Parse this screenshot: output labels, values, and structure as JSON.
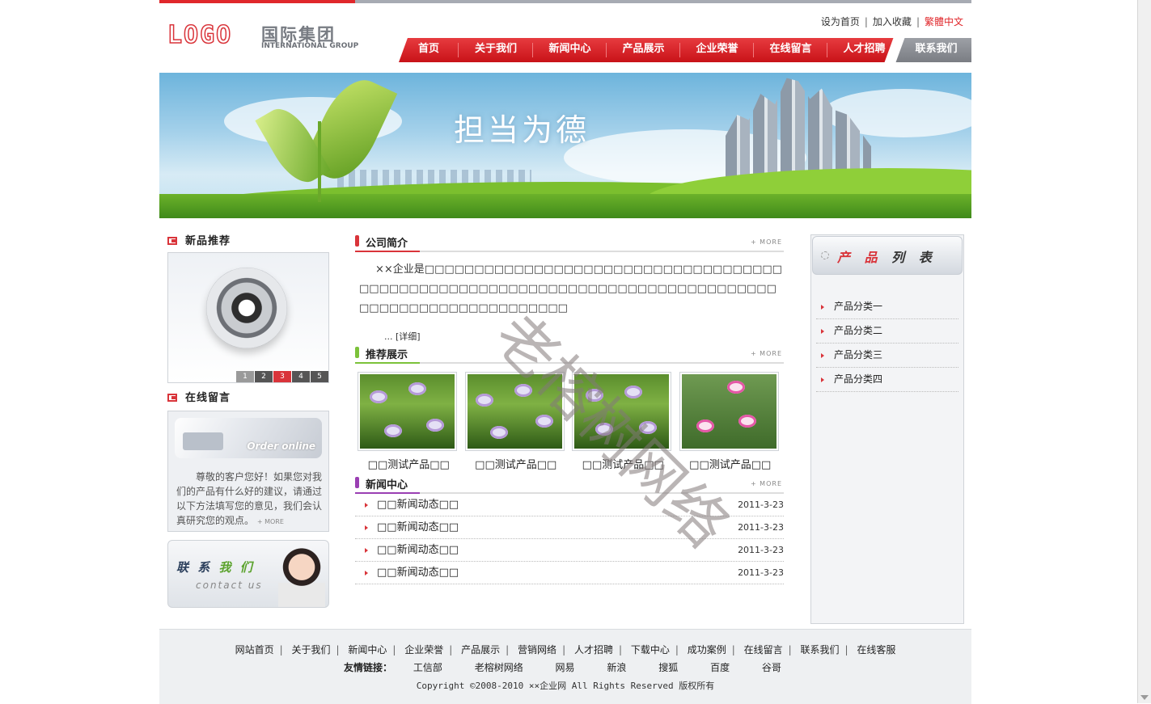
{
  "header": {
    "logo_mark": "LOGO",
    "logo_cn": "国际集团",
    "logo_en": "INTERNATIONAL GROUP",
    "top_links": [
      "设为首页",
      "加入收藏",
      "繁體中文"
    ],
    "nav": [
      "首页",
      "关于我们",
      "新闻中心",
      "产品展示",
      "企业荣誉",
      "在线留言",
      "人才招聘"
    ],
    "nav_contact": "联系我们"
  },
  "banner": {
    "slogan": "担当为德"
  },
  "left": {
    "new_products_title": "新品推荐",
    "pager": [
      "1",
      "2",
      "3",
      "4",
      "5"
    ],
    "message_title": "在线留言",
    "order_online": "Order online",
    "message_text": "尊敬的客户您好！如果您对我们的产品有什么好的建议，请通过以下方法填写您的意见，我们会认真研究您的观点。",
    "message_more": "+ MORE",
    "contact_cn_1": "联 系",
    "contact_cn_2": "我 们",
    "contact_en": "contact us"
  },
  "intro": {
    "title": "公司简介",
    "more": "+ MORE",
    "text": "××企业是□□□□□□□□□□□□□□□□□□□□□□□□□□□□□□□□□□□□□□□□□□□□□□□□□□□□□□□□□□□□□□□□□□□□□□□□□□□□□□□□□□□□□□□□□□□□□□□□□□□",
    "detail": "... [详细]"
  },
  "featured": {
    "title": "推荐展示",
    "more": "+ MORE",
    "items": [
      "□□测试产品□□",
      "□□测试产品□□",
      "□□测试产品□□",
      "□□测试产品□□"
    ]
  },
  "news": {
    "title": "新闻中心",
    "more": "+ MORE",
    "items": [
      {
        "title": "□□新闻动态□□",
        "date": "2011-3-23"
      },
      {
        "title": "□□新闻动态□□",
        "date": "2011-3-23"
      },
      {
        "title": "□□新闻动态□□",
        "date": "2011-3-23"
      },
      {
        "title": "□□新闻动态□□",
        "date": "2011-3-23"
      }
    ]
  },
  "right": {
    "title_red": "产 品",
    "title_dark": "列 表",
    "categories": [
      "产品分类一",
      "产品分类二",
      "产品分类三",
      "产品分类四"
    ]
  },
  "footer": {
    "links": [
      "网站首页",
      "关于我们",
      "新闻中心",
      "企业荣誉",
      "产品展示",
      "营销网络",
      "人才招聘",
      "下载中心",
      "成功案例",
      "在线留言",
      "联系我们",
      "在线客服"
    ],
    "friends_label": "友情链接：",
    "friends": [
      "工信部",
      "老榕树网络",
      "网易",
      "新浪",
      "搜狐",
      "百度",
      "谷哥"
    ],
    "copyright": "Copyright ©2008-2010 ××企业网 All Rights Reserved 版权所有"
  },
  "watermark": "老榕树网络",
  "colors": {
    "brand_red": "#e0272b",
    "nav_grey": "#8a8d93"
  }
}
